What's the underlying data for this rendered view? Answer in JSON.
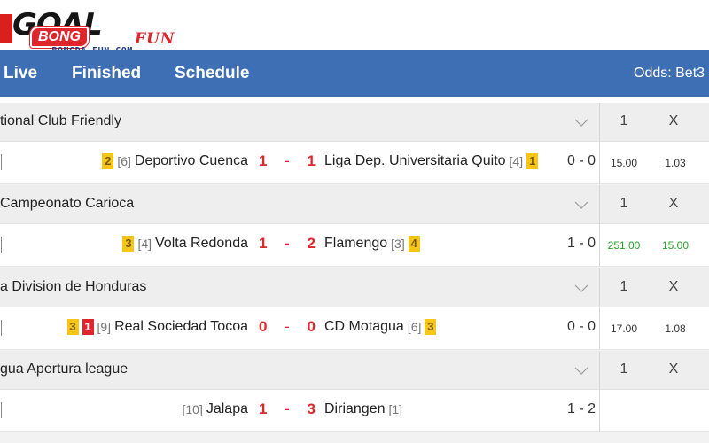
{
  "logo": {
    "goal": "GOAL",
    "bong": "BONG",
    "fun": "FUN",
    "sub": "-BONGDA-FUN.COM-"
  },
  "nav": {
    "tabs": [
      "Live",
      "Finished",
      "Schedule"
    ],
    "odds_label": "Odds:  Bet3"
  },
  "odds_headers": {
    "home": "1",
    "draw": "X"
  },
  "leagues": [
    {
      "name": "tional Club Friendly",
      "match": {
        "home_cards": [
          {
            "type": "yellow",
            "count": "2"
          }
        ],
        "home_rank": "[6]",
        "home": "Deportivo Cuenca",
        "score_home": "1",
        "score_away": "1",
        "away": "Liga Dep. Universitaria Quito",
        "away_rank": "[4]",
        "away_cards": [
          {
            "type": "yellow",
            "count": "1"
          }
        ],
        "ht": "0 - 0",
        "odd1": "15.00",
        "oddx": "1.03",
        "odds_green": false
      }
    },
    {
      "name": "Campeonato Carioca",
      "match": {
        "home_cards": [
          {
            "type": "yellow",
            "count": "3"
          }
        ],
        "home_rank": "[4]",
        "home": "Volta Redonda",
        "score_home": "1",
        "score_away": "2",
        "away": "Flamengo",
        "away_rank": "[3]",
        "away_cards": [
          {
            "type": "yellow",
            "count": "4"
          }
        ],
        "ht": "1 - 0",
        "odd1": "251.00",
        "oddx": "15.00",
        "odds_green": true
      }
    },
    {
      "name": "a Division de Honduras",
      "match": {
        "home_cards": [
          {
            "type": "yellow",
            "count": "3"
          },
          {
            "type": "red",
            "count": "1"
          }
        ],
        "home_rank": "[9]",
        "home": "Real Sociedad Tocoa",
        "score_home": "0",
        "score_away": "0",
        "away": "CD Motagua",
        "away_rank": "[6]",
        "away_cards": [
          {
            "type": "yellow",
            "count": "3"
          }
        ],
        "ht": "0 - 0",
        "odd1": "17.00",
        "oddx": "1.08",
        "odds_green": false
      }
    },
    {
      "name": "gua Apertura league",
      "match": {
        "home_cards": [],
        "home_rank": "[10]",
        "home": "Jalapa",
        "score_home": "1",
        "score_away": "3",
        "away": "Diriangen",
        "away_rank": "[1]",
        "away_cards": [],
        "ht": "1 - 2",
        "odd1": "",
        "oddx": "",
        "odds_green": false
      }
    }
  ],
  "colors": {
    "nav_bg": "#3e6fb5",
    "score_red": "#e0262d",
    "card_yellow": "#f5c518",
    "card_red": "#e0262d",
    "odds_green": "#27a02a"
  }
}
